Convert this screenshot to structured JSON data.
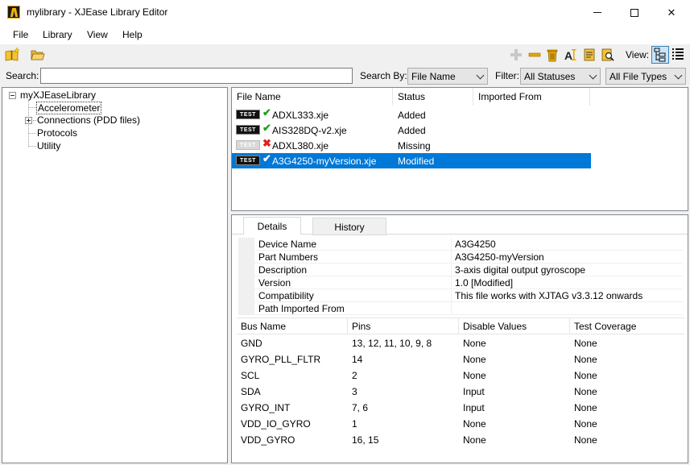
{
  "window": {
    "title": "mylibrary - XJEase Library Editor",
    "controls": {
      "minimize": "minimize-icon",
      "maximize": "maximize-icon",
      "close": "✕"
    }
  },
  "menu": [
    "File",
    "Library",
    "View",
    "Help"
  ],
  "toolbar": {
    "left_icons": [
      "new-library-icon",
      "open-folder-icon"
    ],
    "right_icons": [
      "add-icon",
      "remove-icon",
      "delete-icon",
      "rename-icon",
      "notes-icon",
      "find-icon"
    ],
    "view_label": "View:",
    "view_buttons": [
      "tree-view-icon",
      "list-view-icon"
    ]
  },
  "search": {
    "label": "Search:",
    "value": "",
    "search_by_label": "Search By:",
    "search_by_value": "File Name",
    "filter_label": "Filter:",
    "status_filter_value": "All Statuses",
    "type_filter_value": "All File Types"
  },
  "tree": {
    "root": "myXJEaseLibrary",
    "children": [
      "Accelerometer",
      "Connections (PDD files)",
      "Protocols",
      "Utility"
    ]
  },
  "file_list": {
    "columns": [
      "File Name",
      "Status",
      "Imported From"
    ],
    "rows": [
      {
        "badge": "TEST",
        "status_icon": "✔",
        "name": "ADXL333.xje",
        "status": "Added",
        "imported_from": ""
      },
      {
        "badge": "TEST",
        "status_icon": "✔",
        "name": "AIS328DQ-v2.xje",
        "status": "Added",
        "imported_from": ""
      },
      {
        "badge": "TEST",
        "status_icon": "✖",
        "name": "ADXL380.xje",
        "status": "Missing",
        "imported_from": ""
      },
      {
        "badge": "TEST",
        "status_icon": "✔",
        "name": "A3G4250-myVersion.xje",
        "status": "Modified",
        "imported_from": ""
      }
    ]
  },
  "details": {
    "tabs": [
      "Details",
      "History"
    ],
    "properties": [
      {
        "key": "Device Name",
        "value": "A3G4250"
      },
      {
        "key": "Part Numbers",
        "value": "A3G4250-myVersion"
      },
      {
        "key": "Description",
        "value": "3-axis digital output gyroscope"
      },
      {
        "key": "Version",
        "value": "1.0 [Modified]"
      },
      {
        "key": "Compatibility",
        "value": "This file works with XJTAG v3.3.12 onwards"
      },
      {
        "key": "Path Imported From",
        "value": ""
      }
    ],
    "bus_columns": [
      "Bus Name",
      "Pins",
      "Disable Values",
      "Test Coverage"
    ],
    "buses": [
      {
        "name": "GND",
        "pins": "13, 12, 11, 10, 9, 8",
        "disable": "None",
        "coverage": "None"
      },
      {
        "name": "GYRO_PLL_FLTR",
        "pins": "14",
        "disable": "None",
        "coverage": "None"
      },
      {
        "name": "SCL",
        "pins": "2",
        "disable": "None",
        "coverage": "None"
      },
      {
        "name": "SDA",
        "pins": "3",
        "disable": "Input",
        "coverage": "None"
      },
      {
        "name": "GYRO_INT",
        "pins": "7, 6",
        "disable": "Input",
        "coverage": "None"
      },
      {
        "name": "VDD_IO_GYRO",
        "pins": "1",
        "disable": "None",
        "coverage": "None"
      },
      {
        "name": "VDD_GYRO",
        "pins": "16, 15",
        "disable": "None",
        "coverage": "None"
      }
    ]
  }
}
